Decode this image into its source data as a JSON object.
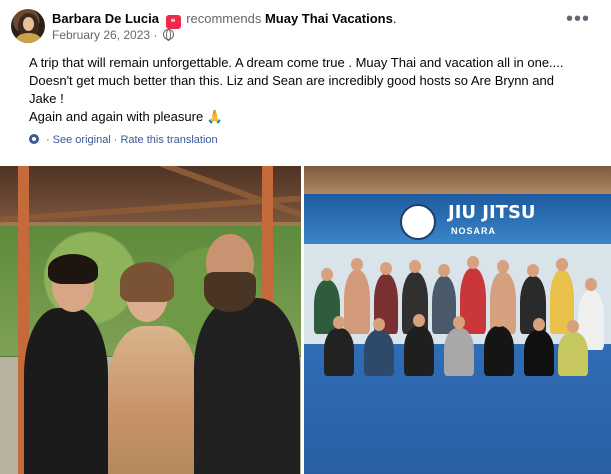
{
  "post": {
    "author": "Barbara De Lucia",
    "action": "recommends",
    "page": "Muay Thai Vacations",
    "trailing_punct": ".",
    "date": "February 26, 2023",
    "separator": "·",
    "text_lines": [
      "A trip that will remain unforgettable. A dream come true . Muay Thai and vacation all in one....",
      "Doesn't get much better than this. Liz and Sean are incredibly good hosts so Are Brynn and",
      "Jake !",
      "Again and again with pleasure"
    ],
    "emoji": "🙏",
    "more_label": "•••",
    "see_original": "See original",
    "dot": "·",
    "rate_translation": "Rate this translation",
    "icons": {
      "recommend": "recommend-icon",
      "audience": "globe-icon",
      "translate": "gear-icon",
      "more": "more-icon"
    },
    "colors": {
      "link": "#385898",
      "secondary": "#65676b",
      "recommend": "#f02849"
    }
  },
  "photo_right_sign": {
    "title": "JIU JITSU",
    "subtitle": "NOSARA"
  }
}
